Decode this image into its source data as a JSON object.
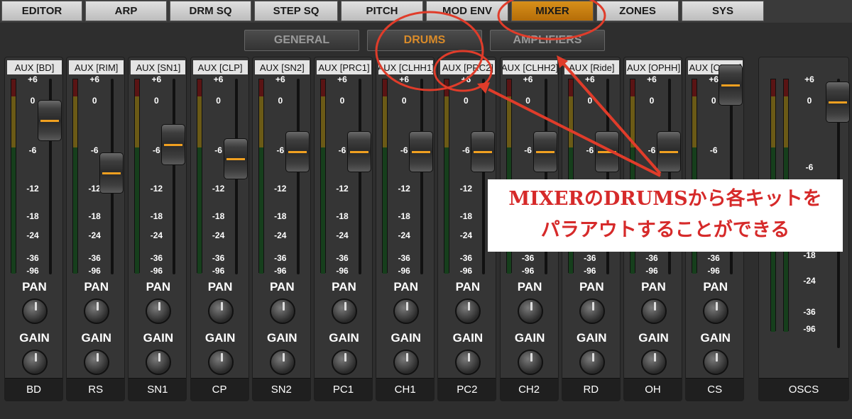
{
  "top_tabs": [
    "EDITOR",
    "ARP",
    "DRM SQ",
    "STEP SQ",
    "PITCH",
    "MOD ENV",
    "MIXER",
    "ZONES",
    "SYS"
  ],
  "active_top_tab": "MIXER",
  "sub_tabs": [
    "GENERAL",
    "DRUMS",
    "AMPLIFIERS"
  ],
  "active_sub_tab": "DRUMS",
  "scale_labels": [
    "+6",
    "0",
    "-6",
    "-12",
    "-18",
    "-24",
    "-36",
    "-96"
  ],
  "osc_scale_labels": [
    "+6",
    "0",
    "-6",
    "-18",
    "-24",
    "-36",
    "-96"
  ],
  "knob_labels": {
    "pan": "PAN",
    "gain": "GAIN"
  },
  "channels": [
    {
      "aux": "AUX [BD]",
      "name": "BD",
      "fader": "0"
    },
    {
      "aux": "AUX [RIM]",
      "name": "RS",
      "fader": "-6"
    },
    {
      "aux": "AUX [SN1]",
      "name": "SN1",
      "fader": "-6"
    },
    {
      "aux": "AUX [CLP]",
      "name": "CP",
      "fader": "-6"
    },
    {
      "aux": "AUX [SN2]",
      "name": "SN2",
      "fader": "-6"
    },
    {
      "aux": "AUX [PRC1]",
      "name": "PC1",
      "fader": "-6"
    },
    {
      "aux": "AUX [CLHH1]",
      "name": "CH1",
      "fader": "-6"
    },
    {
      "aux": "AUX [PRC2]",
      "name": "PC2",
      "fader": "-6"
    },
    {
      "aux": "AUX [CLHH2]",
      "name": "CH2",
      "fader": "-6"
    },
    {
      "aux": "AUX [Ride]",
      "name": "RD",
      "fader": "-6"
    },
    {
      "aux": "AUX [OPHH]",
      "name": "OH",
      "fader": "-6"
    },
    {
      "aux": "AUX [CRSH]",
      "name": "CS",
      "fader": "0"
    }
  ],
  "osc_strip": {
    "name": "OSCS",
    "fader": "0"
  },
  "annotation": {
    "line1": "MIXERのDRUMSから各キットを",
    "line2": "パラアウトすることができる"
  },
  "colors": {
    "accent": "#d7901a",
    "annotation": "#d62a2a"
  }
}
